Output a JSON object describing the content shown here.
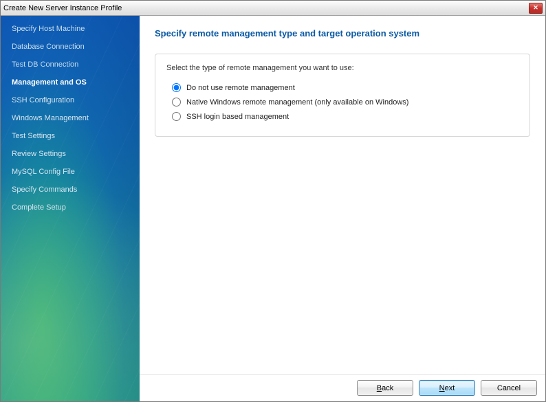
{
  "window": {
    "title": "Create New Server Instance Profile"
  },
  "sidebar": {
    "items": [
      {
        "label": "Specify Host Machine",
        "state": "done"
      },
      {
        "label": "Database Connection",
        "state": "done"
      },
      {
        "label": "Test DB Connection",
        "state": "done"
      },
      {
        "label": "Management and OS",
        "state": "active"
      },
      {
        "label": "SSH Configuration",
        "state": "pending"
      },
      {
        "label": "Windows Management",
        "state": "pending"
      },
      {
        "label": "Test Settings",
        "state": "pending"
      },
      {
        "label": "Review Settings",
        "state": "pending"
      },
      {
        "label": "MySQL Config File",
        "state": "pending"
      },
      {
        "label": "Specify Commands",
        "state": "pending"
      },
      {
        "label": "Complete Setup",
        "state": "pending"
      }
    ]
  },
  "main": {
    "heading": "Specify remote management type and target operation system",
    "group_label": "Select the type of remote management you want to use:",
    "options": [
      {
        "label": "Do not use remote management",
        "selected": true
      },
      {
        "label": "Native Windows remote management (only available on Windows)",
        "selected": false
      },
      {
        "label": "SSH login based management",
        "selected": false
      }
    ]
  },
  "footer": {
    "back": "Back",
    "next": "Next",
    "cancel": "Cancel"
  }
}
